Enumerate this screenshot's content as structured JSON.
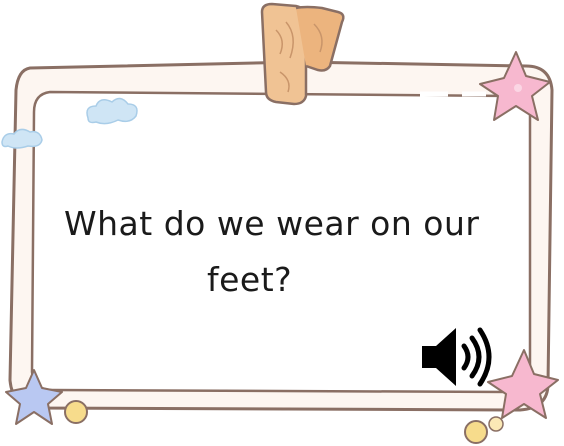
{
  "card": {
    "question_line1": "What do we wear on our",
    "question_line2": "feet?"
  },
  "icons": {
    "audio": "speaker-icon",
    "decorations": [
      "clothespin-icon",
      "star-icon",
      "cloud-icon",
      "bubble-icon"
    ]
  },
  "colors": {
    "frame_outline": "#8a6f64",
    "frame_fill": "#fdf5f0",
    "star_pink": "#f7b8cf",
    "star_blue": "#b9c8f2",
    "cloud_blue": "#cfe5f5",
    "bubble_yellow": "#f7dc8c",
    "clothespin": "#f0c394",
    "text": "#1a1a1a"
  }
}
